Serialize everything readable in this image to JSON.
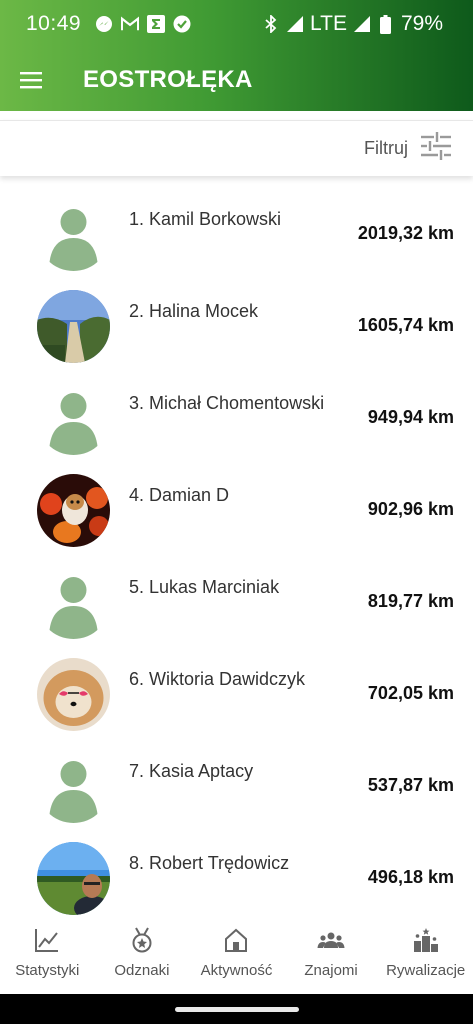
{
  "status_bar": {
    "time": "10:49",
    "network": "LTE",
    "battery": "79%",
    "left_icons": [
      "messenger-icon",
      "gmail-icon",
      "sigma-app-icon",
      "check-badge-icon"
    ],
    "right_icons": [
      "bluetooth-icon",
      "wifi-signal-icon",
      "cell-signal-icon",
      "battery-icon"
    ]
  },
  "app_bar": {
    "title": "EOSTROŁĘKA",
    "menu_icon": "hamburger-menu-icon"
  },
  "filter_bar": {
    "label": "Filtruj",
    "icon": "sliders-icon"
  },
  "leaderboard": [
    {
      "rank_name": "1. Kamil Borkowski",
      "distance": "2019,32 km",
      "avatar": "generic"
    },
    {
      "rank_name": "2. Halina Mocek",
      "distance": "1605,74 km",
      "avatar": "photo-beach-path"
    },
    {
      "rank_name": "3. Michał Chomentowski",
      "distance": "949,94 km",
      "avatar": "generic"
    },
    {
      "rank_name": "4. Damian D",
      "distance": "902,96 km",
      "avatar": "photo-dog-pumpkins"
    },
    {
      "rank_name": "5. Lukas Marciniak",
      "distance": "819,77 km",
      "avatar": "generic"
    },
    {
      "rank_name": "6. Wiktoria Dawidczyk",
      "distance": "702,05 km",
      "avatar": "photo-dog-sunglasses"
    },
    {
      "rank_name": "7. Kasia Aptacy",
      "distance": "537,87 km",
      "avatar": "generic"
    },
    {
      "rank_name": "8. Robert Trędowicz",
      "distance": "496,18 km",
      "avatar": "photo-man-field"
    }
  ],
  "bottom_nav": [
    {
      "label": "Statystyki",
      "icon": "line-chart-icon"
    },
    {
      "label": "Odznaki",
      "icon": "medal-icon"
    },
    {
      "label": "Aktywność",
      "icon": "home-icon"
    },
    {
      "label": "Znajomi",
      "icon": "group-icon"
    },
    {
      "label": "Rywalizacje",
      "icon": "podium-icon"
    }
  ],
  "colors": {
    "appbar_start": "#6cb846",
    "appbar_end": "#0e5a1b",
    "generic_avatar": "#8fb58a"
  }
}
